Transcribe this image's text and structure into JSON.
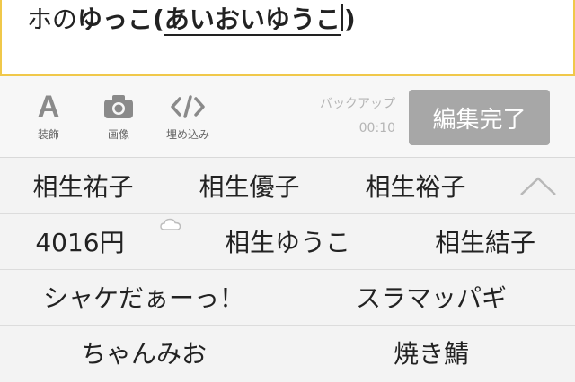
{
  "editor": {
    "segments": [
      {
        "text": "ホの",
        "style": "normal"
      },
      {
        "text": "ゆっこ(",
        "style": "bold"
      },
      {
        "text": "あいおいゆうこ",
        "style": "underline"
      },
      {
        "text": ")",
        "style": "bold"
      }
    ]
  },
  "toolbar": {
    "decorate_glyph": "A",
    "decorate_label": "装飾",
    "image_label": "画像",
    "embed_label": "埋め込み",
    "backup_label": "バックアップ",
    "backup_time": "00:10",
    "done_label": "編集完了"
  },
  "suggestions": {
    "row1": [
      "相生祐子",
      "相生優子",
      "相生裕子"
    ],
    "row2": [
      "4016円",
      "相生ゆうこ",
      "相生結子"
    ],
    "row3": [
      "シャケだぁーっ！",
      "スラマッパギ"
    ],
    "row4": [
      "ちゃんみお",
      "焼き鯖"
    ]
  },
  "icons": {
    "decorate": "letter-a-icon",
    "image": "camera-icon",
    "embed": "code-icon",
    "collapse": "chevron-up-icon",
    "cloud": "cloud-icon"
  },
  "colors": {
    "editor_border": "#f0c84a",
    "done_button": "#a7a7a7",
    "toolbar_bg": "#f7f7f7"
  }
}
